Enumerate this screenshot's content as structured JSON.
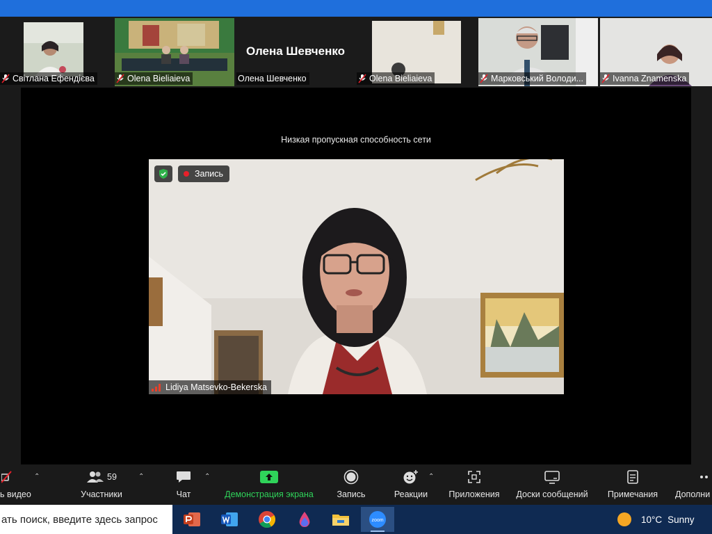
{
  "gallery": {
    "participants": [
      {
        "name": "Світлана Ефендієва",
        "muted": true
      },
      {
        "name": "Olena Bieliaieva",
        "muted": true
      },
      {
        "name": "Олена Шевченко",
        "muted": false,
        "display_name": "Олена Шевченко"
      },
      {
        "name": "Olena Bieliaieva",
        "muted": true
      },
      {
        "name": "Марковський Володи...",
        "muted": true
      },
      {
        "name": "Ivanna Znamenska",
        "muted": true
      }
    ]
  },
  "stage": {
    "network_warning": "Низкая пропускная способность сети",
    "recording_label": "Запись",
    "speaker_name": "Lidiya Matsevko-Bekerska"
  },
  "toolbar": {
    "video_label": "ь видео",
    "participants_label": "Участники",
    "participants_count": "59",
    "chat_label": "Чат",
    "share_label": "Демонстрация экрана",
    "record_label": "Запись",
    "reactions_label": "Реакции",
    "apps_label": "Приложения",
    "whiteboards_label": "Доски сообщений",
    "notes_label": "Примечания",
    "more_label": "Дополни"
  },
  "taskbar": {
    "search_placeholder": "ать поиск, введите здесь запрос",
    "apps": [
      "powerpoint-icon",
      "word-icon",
      "chrome-icon",
      "paint-icon",
      "file-explorer-icon",
      "zoom-icon"
    ],
    "zoom_label": "zoom",
    "weather_temp": "10°C",
    "weather_text": "Sunny"
  },
  "colors": {
    "accent_blue": "#1f6fdc",
    "share_green": "#2fd35a",
    "muted_red": "#e8202a",
    "taskbar": "#0f2a52"
  }
}
